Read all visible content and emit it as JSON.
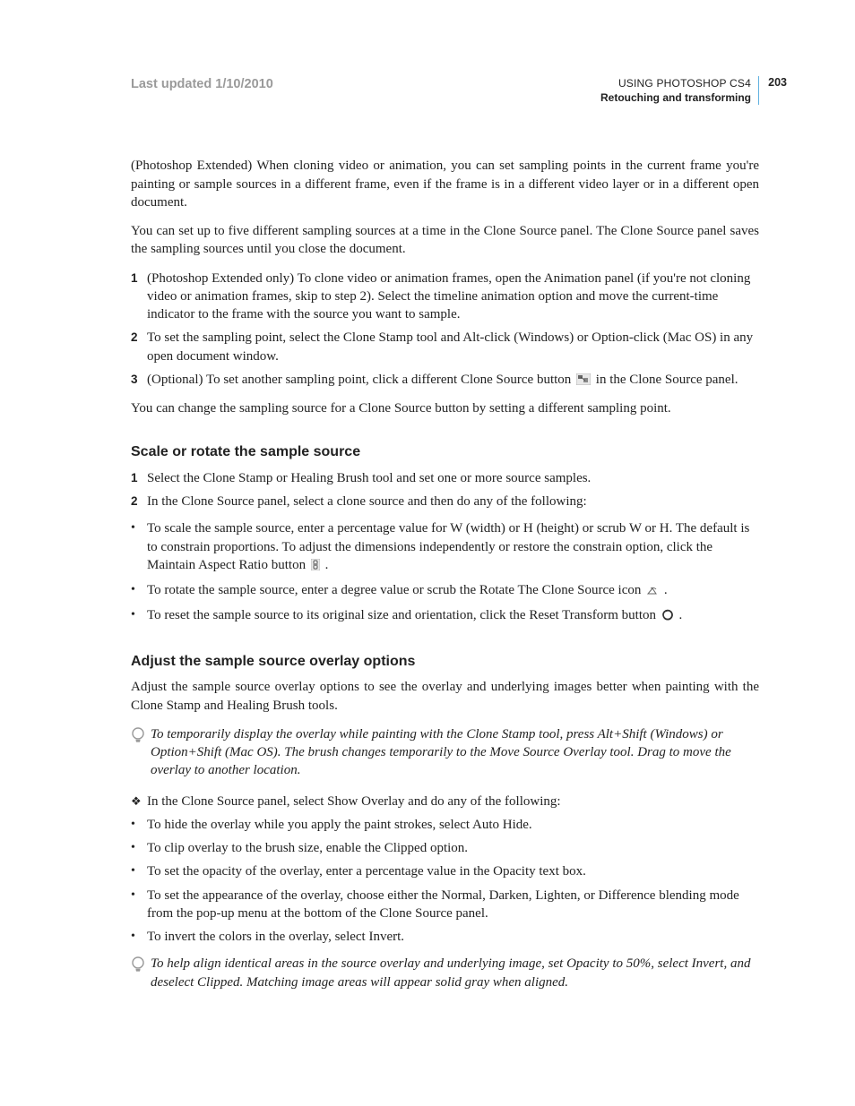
{
  "header": {
    "last_updated": "Last updated 1/10/2010",
    "doc_title": "USING PHOTOSHOP CS4",
    "section": "Retouching and transforming",
    "page_number": "203"
  },
  "body": {
    "p1": "(Photoshop Extended) When cloning video or animation, you can set sampling points in the current frame you're painting or sample sources in a different frame, even if the frame is in a different video layer or in a different open document.",
    "p2": "You can set up to five different sampling sources at a time in the Clone Source panel. The Clone Source panel saves the sampling sources until you close the document.",
    "steps_a": [
      "(Photoshop Extended only) To clone video or animation frames, open the Animation panel (if you're not cloning video or animation frames, skip to step 2). Select the timeline animation option and move the current-time indicator to the frame with the source you want to sample.",
      "To set the sampling point, select the Clone Stamp tool and Alt-click (Windows) or Option-click (Mac OS) in any open document window."
    ],
    "step_a3_pre": "(Optional) To set another sampling point, click a different Clone Source button ",
    "step_a3_post": " in the Clone Source panel.",
    "p3": "You can change the sampling source for a Clone Source button by setting a different sampling point.",
    "h1": "Scale or rotate the sample source",
    "steps_b": [
      "Select the Clone Stamp or Healing Brush tool and set one or more source samples.",
      "In the Clone Source panel, select a clone source and then do any of the following:"
    ],
    "bullets_b": {
      "b1_pre": "To scale the sample source, enter a percentage value for W (width) or H (height) or scrub W or H. The default is to constrain proportions. To adjust the dimensions independently or restore the constrain option, click the Maintain Aspect Ratio button ",
      "b1_post": ".",
      "b2_pre": "To rotate the sample source, enter a degree value or scrub the Rotate The Clone Source icon ",
      "b2_post": ".",
      "b3_pre": "To reset the sample source to its original size and orientation, click the Reset Transform button ",
      "b3_post": "."
    },
    "h2": "Adjust the sample source overlay options",
    "p4": "Adjust the sample source overlay options to see the overlay and underlying images better when painting with the Clone Stamp and Healing Brush tools.",
    "tip1": "To temporarily display the overlay while painting with the Clone Stamp tool, press Alt+Shift (Windows) or Option+Shift (Mac OS). The brush changes temporarily to the Move Source Overlay tool. Drag to move the overlay to another location.",
    "diamond_text": "In the Clone Source panel, select Show Overlay and do any of the following:",
    "bullets_c": [
      "To hide the overlay while you apply the paint strokes, select Auto Hide.",
      "To clip overlay to the brush size, enable the Clipped option.",
      "To set the opacity of the overlay, enter a percentage value in the Opacity text box.",
      "To set the appearance of the overlay, choose either the Normal, Darken, Lighten, or Difference blending mode from the pop-up menu at the bottom of the Clone Source panel.",
      "To invert the colors in the overlay, select Invert."
    ],
    "tip2": "To help align identical areas in the source overlay and underlying image, set Opacity to 50%, select Invert, and deselect Clipped. Matching image areas will appear solid gray when aligned."
  }
}
